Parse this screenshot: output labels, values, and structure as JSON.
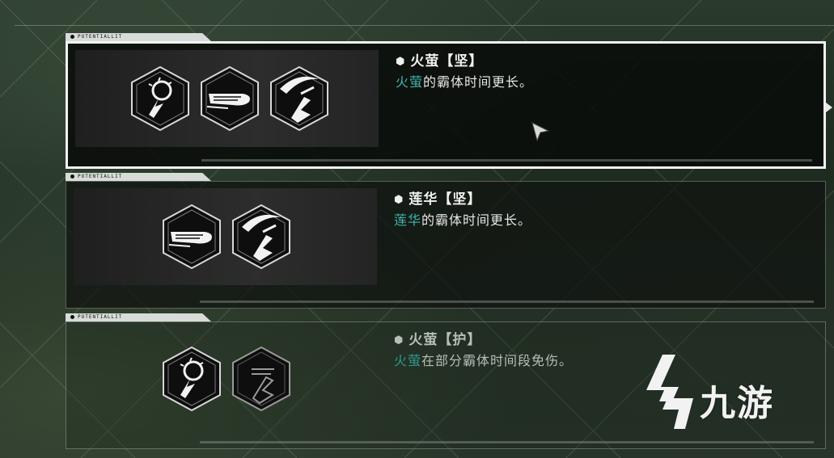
{
  "cards": [
    {
      "tab_code": "POTENTIALLIT",
      "title": "火萤【坚】",
      "desc_highlight": "火萤",
      "desc_rest": "的霸体时间更长。",
      "icons": [
        "firefly-dash-icon",
        "speed-slash-icon",
        "scythe-leap-icon"
      ],
      "state": "selected"
    },
    {
      "tab_code": "POTENTIALLIT",
      "title": "莲华【坚】",
      "desc_highlight": "莲华",
      "desc_rest": "的霸体时间更长。",
      "icons": [
        "speed-slash-icon",
        "scythe-leap-icon"
      ],
      "state": "normal"
    },
    {
      "tab_code": "POTENTIALLIT",
      "title": "火萤【护】",
      "desc_highlight": "火萤",
      "desc_rest": "在部分霸体时间段免伤。",
      "icons": [
        "firefly-dash-icon",
        "scythe-leap-locked-icon"
      ],
      "state": "dim"
    }
  ],
  "watermark": {
    "text": "九游"
  },
  "colors": {
    "highlight": "#3fb6b0",
    "selected_border": "#f2f2f2"
  }
}
